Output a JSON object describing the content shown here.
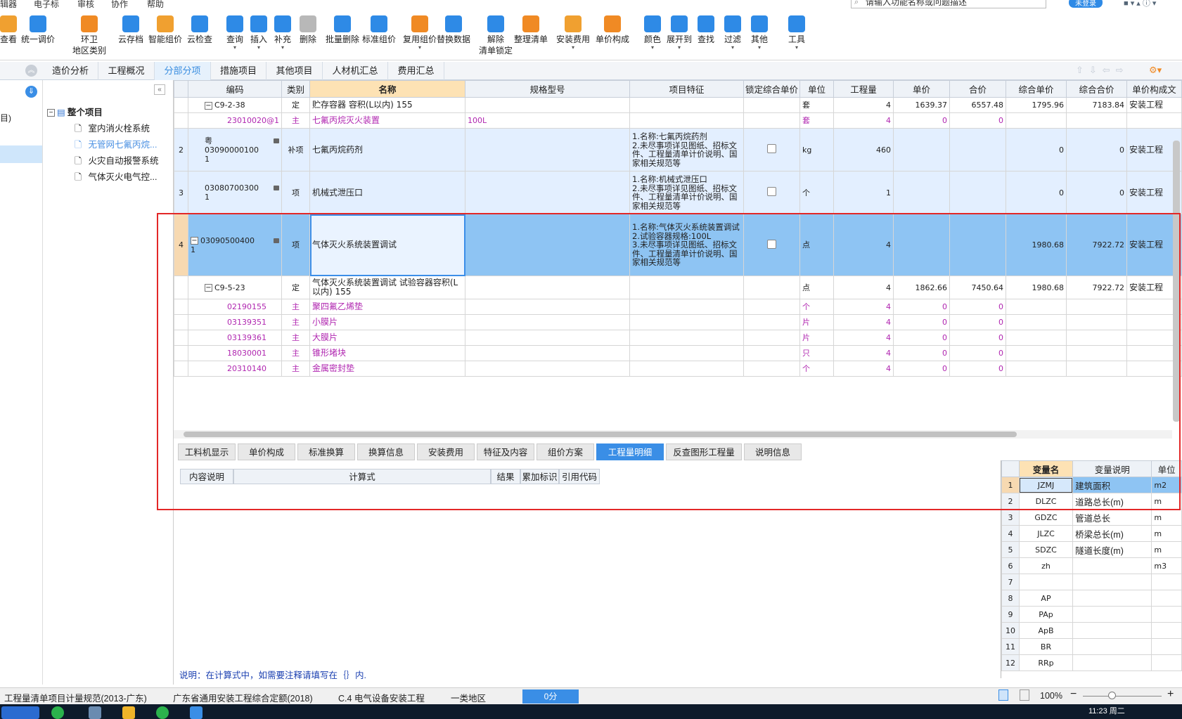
{
  "menu": [
    "辑器",
    "电子标",
    "审核",
    "协作",
    "帮助"
  ],
  "search_placeholder": "请输入功能名称或问题描述",
  "login_label": "未登录",
  "toolbar": [
    {
      "label": "查看",
      "color": "#f0a030"
    },
    {
      "label": "统一调价",
      "color": "#2e8ae6"
    },
    {
      "label": "环卫\n地区类别",
      "color": "#f08a24"
    },
    {
      "label": "云存档",
      "color": "#2e8ae6"
    },
    {
      "label": "智能组价",
      "color": "#f0a030"
    },
    {
      "label": "云检查",
      "color": "#2e8ae6"
    },
    {
      "label": "查询",
      "color": "#2e8ae6"
    },
    {
      "label": "插入",
      "color": "#2e8ae6"
    },
    {
      "label": "补充",
      "color": "#2e8ae6"
    },
    {
      "label": "删除",
      "color": "#b8b8b8"
    },
    {
      "label": "批量删除",
      "color": "#2e8ae6"
    },
    {
      "label": "标准组价",
      "color": "#2e8ae6"
    },
    {
      "label": "复用组价",
      "color": "#f08a24"
    },
    {
      "label": "替换数据",
      "color": "#2e8ae6"
    },
    {
      "label": "解除\n清单锁定",
      "color": "#2e8ae6"
    },
    {
      "label": "整理清单",
      "color": "#f08a24"
    },
    {
      "label": "安装费用",
      "color": "#f0a030"
    },
    {
      "label": "单价构成",
      "color": "#f08a24"
    },
    {
      "label": "颜色",
      "color": "#2e8ae6"
    },
    {
      "label": "展开到",
      "color": "#2e8ae6"
    },
    {
      "label": "查找",
      "color": "#2e8ae6"
    },
    {
      "label": "过滤",
      "color": "#2e8ae6"
    },
    {
      "label": "其他",
      "color": "#2e8ae6"
    },
    {
      "label": "工具",
      "color": "#2e8ae6"
    }
  ],
  "tabs": [
    "造价分析",
    "工程概况",
    "分部分项",
    "措施项目",
    "其他项目",
    "人材机汇总",
    "费用汇总"
  ],
  "active_tab": "分部分项",
  "left_label": "目)",
  "tree": {
    "root": "整个项目",
    "items": [
      "室内消火栓系统",
      "无管网七氟丙烷...",
      "火灾自动报警系统",
      "气体灭火电气控..."
    ]
  },
  "grid": {
    "columns": [
      "编码",
      "类别",
      "名称",
      "规格型号",
      "项目特征",
      "锁定综合单价",
      "单位",
      "工程量",
      "单价",
      "合价",
      "综合单价",
      "综合合价",
      "单价构成文"
    ],
    "rows": [
      {
        "no": "",
        "code": "C9-2-38",
        "type": "定",
        "name": "贮存容器 容积(L以内) 155",
        "spec": "",
        "feature": "",
        "lock": false,
        "unit": "套",
        "qty": "4",
        "price": "1639.37",
        "total": "6557.48",
        "cprice": "1795.96",
        "ctotal": "7183.84",
        "cat": "安装工程",
        "kind": "sub2"
      },
      {
        "no": "",
        "code": "23010020@1",
        "type": "主",
        "name": "七氟丙烷灭火装置",
        "spec": "100L",
        "feature": "",
        "lock": false,
        "unit": "套",
        "qty": "4",
        "price": "0",
        "total": "0",
        "cprice": "",
        "ctotal": "",
        "cat": "",
        "kind": "mat"
      },
      {
        "no": "2",
        "code": "粤\n03090000100\n1",
        "type": "补项",
        "name": "七氟丙烷药剂",
        "spec": "",
        "feature": "1.名称:七氟丙烷药剂\n2.未尽事项详见图纸、招标文件、工程量清单计价说明、国家相关规范等",
        "lock": true,
        "unit": "kg",
        "qty": "460",
        "price": "",
        "total": "",
        "cprice": "0",
        "ctotal": "0",
        "cat": "安装工程",
        "kind": "bill"
      },
      {
        "no": "3",
        "code": "03080700300\n1",
        "type": "项",
        "name": "机械式泄压口",
        "spec": "",
        "feature": "1.名称:机械式泄压口\n2.未尽事项详见图纸、招标文件、工程量清单计价说明、国家相关规范等",
        "lock": true,
        "unit": "个",
        "qty": "1",
        "price": "",
        "total": "",
        "cprice": "0",
        "ctotal": "0",
        "cat": "安装工程",
        "kind": "bill"
      },
      {
        "no": "4",
        "code": "03090500400\n1",
        "type": "项",
        "name": "气体灭火系统装置调试",
        "spec": "",
        "feature": "1.名称:气体灭火系统装置调试\n2.试验容器规格:100L\n3.未尽事项详见图纸、招标文件、工程量清单计价说明、国家相关规范等",
        "lock": true,
        "unit": "点",
        "qty": "4",
        "price": "",
        "total": "",
        "cprice": "1980.68",
        "ctotal": "7922.72",
        "cat": "安装工程",
        "kind": "sel"
      },
      {
        "no": "",
        "code": "C9-5-23",
        "type": "定",
        "name": "气体灭火系统装置调试 试验容器容积(L以内) 155",
        "spec": "",
        "feature": "",
        "lock": false,
        "unit": "点",
        "qty": "4",
        "price": "1862.66",
        "total": "7450.64",
        "cprice": "1980.68",
        "ctotal": "7922.72",
        "cat": "安装工程",
        "kind": "sub"
      },
      {
        "no": "",
        "code": "02190155",
        "type": "主",
        "name": "聚四氟乙烯垫",
        "spec": "",
        "feature": "",
        "lock": false,
        "unit": "个",
        "qty": "4",
        "price": "0",
        "total": "0",
        "cprice": "",
        "ctotal": "",
        "cat": "",
        "kind": "mat"
      },
      {
        "no": "",
        "code": "03139351",
        "type": "主",
        "name": "小膜片",
        "spec": "",
        "feature": "",
        "lock": false,
        "unit": "片",
        "qty": "4",
        "price": "0",
        "total": "0",
        "cprice": "",
        "ctotal": "",
        "cat": "",
        "kind": "mat"
      },
      {
        "no": "",
        "code": "03139361",
        "type": "主",
        "name": "大膜片",
        "spec": "",
        "feature": "",
        "lock": false,
        "unit": "片",
        "qty": "4",
        "price": "0",
        "total": "0",
        "cprice": "",
        "ctotal": "",
        "cat": "",
        "kind": "mat"
      },
      {
        "no": "",
        "code": "18030001",
        "type": "主",
        "name": "锥形堵块",
        "spec": "",
        "feature": "",
        "lock": false,
        "unit": "只",
        "qty": "4",
        "price": "0",
        "total": "0",
        "cprice": "",
        "ctotal": "",
        "cat": "",
        "kind": "mat"
      },
      {
        "no": "",
        "code": "20310140",
        "type": "主",
        "name": "金属密封垫",
        "spec": "",
        "feature": "",
        "lock": false,
        "unit": "个",
        "qty": "4",
        "price": "0",
        "total": "0",
        "cprice": "",
        "ctotal": "",
        "cat": "",
        "kind": "mat"
      }
    ]
  },
  "bottom_tabs": [
    "工料机显示",
    "单价构成",
    "标准换算",
    "换算信息",
    "安装费用",
    "特征及内容",
    "组价方案",
    "工程量明细",
    "反查图形工程量",
    "说明信息"
  ],
  "active_bottom_tab": "工程量明细",
  "detail_columns": [
    "内容说明",
    "计算式",
    "结果",
    "累加标识",
    "引用代码"
  ],
  "note": "说明：在计算式中，如需要注释请填写在｛｝内.",
  "vars": {
    "columns": [
      "变量名",
      "变量说明",
      "单位"
    ],
    "rows": [
      {
        "no": "1",
        "code": "JZMJ",
        "desc": "建筑面积",
        "unit": "m2"
      },
      {
        "no": "2",
        "code": "DLZC",
        "desc": "道路总长(m)",
        "unit": "m"
      },
      {
        "no": "3",
        "code": "GDZC",
        "desc": "管道总长",
        "unit": "m"
      },
      {
        "no": "4",
        "code": "JLZC",
        "desc": "桥梁总长(m)",
        "unit": "m"
      },
      {
        "no": "5",
        "code": "SDZC",
        "desc": "隧道长度(m)",
        "unit": "m"
      },
      {
        "no": "6",
        "code": "zh",
        "desc": "",
        "unit": "m3"
      },
      {
        "no": "7",
        "code": "",
        "desc": "",
        "unit": ""
      },
      {
        "no": "8",
        "code": "AP",
        "desc": "",
        "unit": ""
      },
      {
        "no": "9",
        "code": "PAp",
        "desc": "",
        "unit": ""
      },
      {
        "no": "10",
        "code": "ApB",
        "desc": "",
        "unit": ""
      },
      {
        "no": "11",
        "code": "BR",
        "desc": "",
        "unit": ""
      },
      {
        "no": "12",
        "code": "RRp",
        "desc": "",
        "unit": ""
      }
    ]
  },
  "status": {
    "spec": "工程量清单项目计量规范(2013-广东)",
    "quota": "广东省通用安装工程综合定额(2018)",
    "section": "C.4 电气设备安装工程",
    "region": "一类地区",
    "score": "0分",
    "zoom": "100%"
  },
  "clock": "11:23 周二"
}
